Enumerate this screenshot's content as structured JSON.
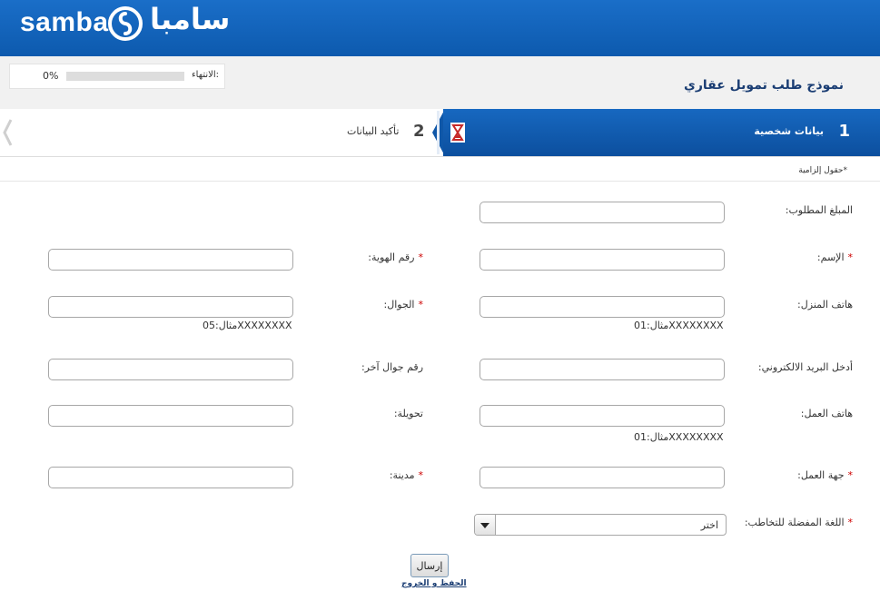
{
  "brand": {
    "name_en": "samba",
    "name_ar": "سامبا",
    "color": "#1a6ec8"
  },
  "progress": {
    "label": "الانتهاء:",
    "percent_text": "0%",
    "value": 0
  },
  "form": {
    "title": "نموذج طلب تمويل عقاري",
    "required_note": "*حقول إلزامية"
  },
  "steps": [
    {
      "number": "1",
      "label": "بيانات شخصية",
      "active": true
    },
    {
      "number": "2",
      "label": "تأكيد البيانات",
      "active": false
    }
  ],
  "fields": {
    "amount": {
      "label": "المبلغ المطلوب:",
      "value": ""
    },
    "name": {
      "label": "الإسم:",
      "required": true,
      "value": ""
    },
    "id_number": {
      "label": "رقم الهوية:",
      "required": true,
      "value": ""
    },
    "home_phone": {
      "label": "هاتف المنزل:",
      "value": "",
      "hint": "مثال:01XXXXXXXX"
    },
    "mobile": {
      "label": "الجوال:",
      "required": true,
      "value": "",
      "hint": "مثال:05XXXXXXXX"
    },
    "email": {
      "label": "أدخل البريد الالكتروني:",
      "value": ""
    },
    "other_mobile": {
      "label": "رقم جوال آخر:",
      "value": ""
    },
    "work_phone": {
      "label": "هاتف العمل:",
      "value": "",
      "hint": "مثال:01XXXXXXXX"
    },
    "extension": {
      "label": "تحويلة:",
      "value": ""
    },
    "employer": {
      "label": "جهة العمل:",
      "required": true,
      "value": ""
    },
    "city": {
      "label": "مدينة:",
      "required": true,
      "value": ""
    },
    "language": {
      "label": "اللغة المفضلة للتخاطب:",
      "required": true,
      "selected": "اختر"
    }
  },
  "actions": {
    "submit": "إرسال",
    "save_exit": "الحفظ و الخروج"
  }
}
